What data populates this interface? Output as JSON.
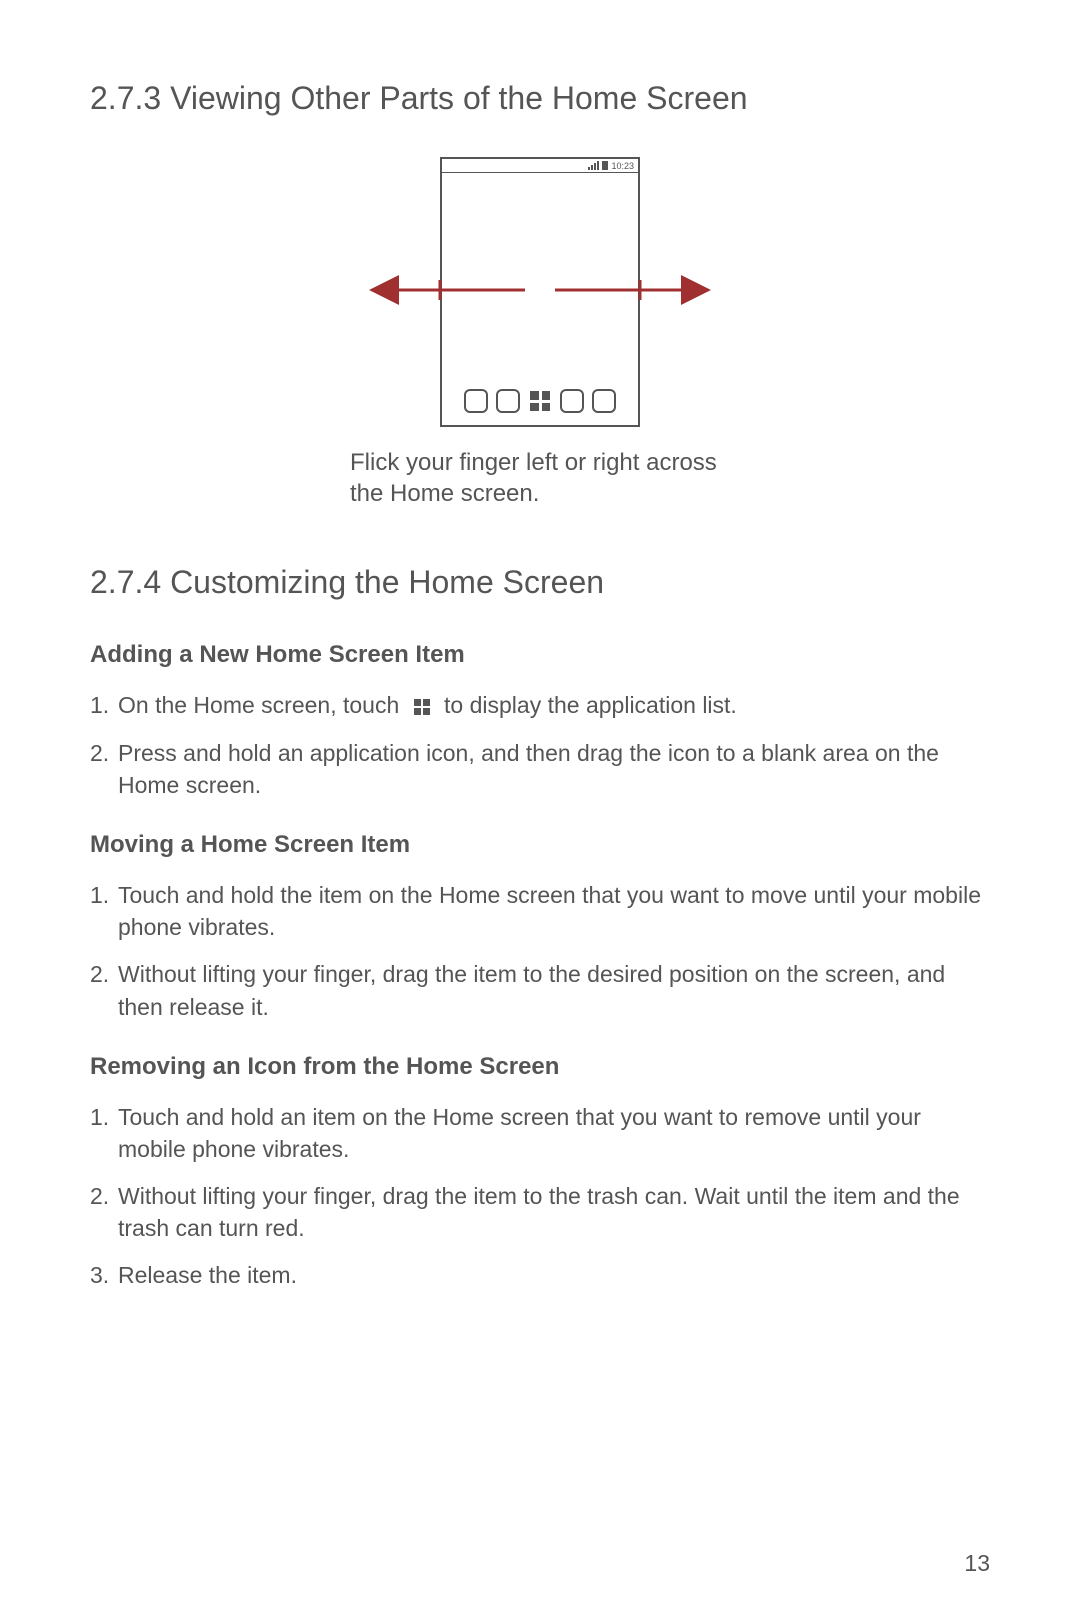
{
  "section1": {
    "heading": "2.7.3  Viewing Other Parts of the Home Screen",
    "diagram": {
      "status_time": "10:23"
    },
    "caption": "Flick your finger left or right across the Home screen."
  },
  "section2": {
    "heading": "2.7.4  Customizing the Home Screen",
    "subsections": [
      {
        "title": "Adding a New Home Screen Item",
        "steps": [
          {
            "pre": "On the Home screen, touch",
            "has_icon": true,
            "post": "to display the application list."
          },
          {
            "pre": "Press and hold an application icon, and then drag the icon to a blank area on the Home screen.",
            "has_icon": false,
            "post": ""
          }
        ]
      },
      {
        "title": "Moving a Home Screen Item",
        "steps": [
          {
            "pre": "Touch and hold the item on the Home screen that you want to move until your mobile phone vibrates.",
            "has_icon": false,
            "post": ""
          },
          {
            "pre": "Without lifting your finger, drag the item to the desired position on the screen, and then release it.",
            "has_icon": false,
            "post": ""
          }
        ]
      },
      {
        "title": "Removing an Icon from the Home Screen",
        "steps": [
          {
            "pre": "Touch and hold an item on the Home screen that you want to remove until your mobile phone vibrates.",
            "has_icon": false,
            "post": ""
          },
          {
            "pre": "Without lifting your finger, drag the item to the trash can. Wait until the item and the trash can turn red.",
            "has_icon": false,
            "post": ""
          },
          {
            "pre": "Release the item.",
            "has_icon": false,
            "post": ""
          }
        ]
      }
    ]
  },
  "page_number": "13"
}
